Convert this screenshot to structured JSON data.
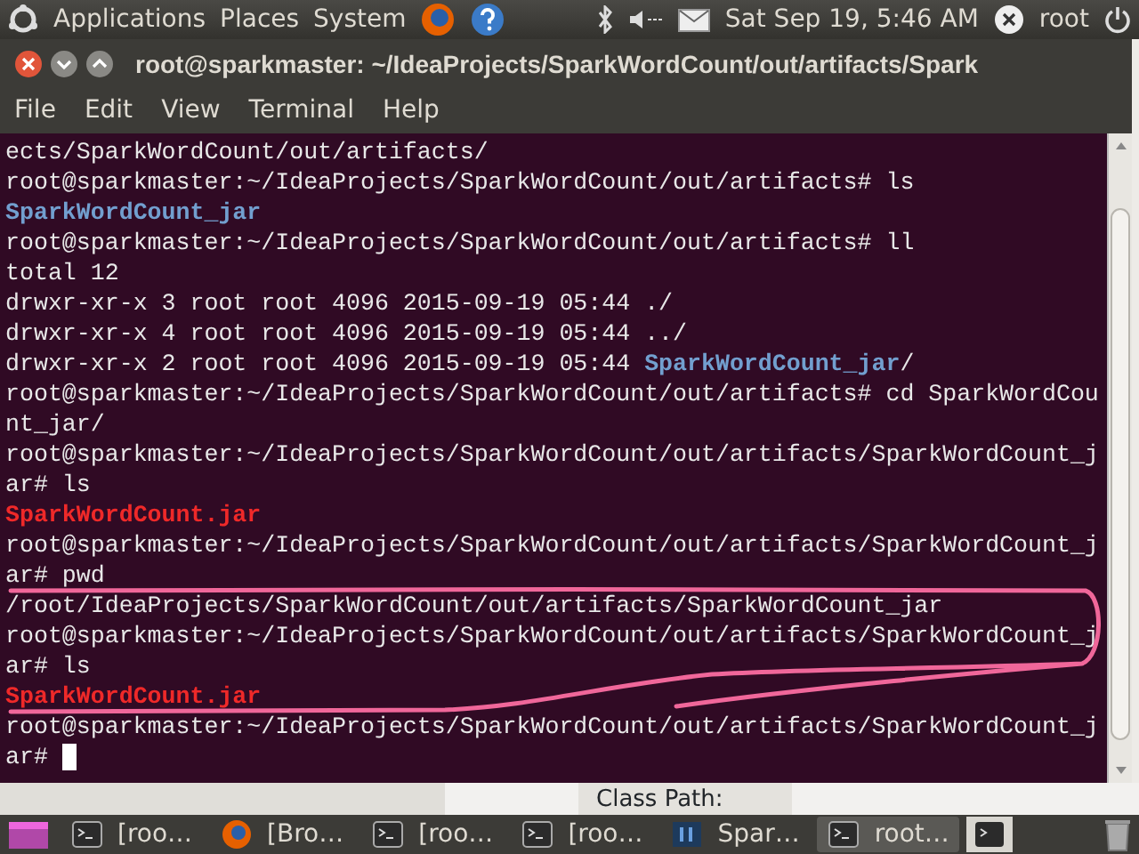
{
  "top_panel": {
    "menus": [
      "Applications",
      "Places",
      "System"
    ],
    "clock": "Sat Sep 19,  5:46 AM",
    "user": "root"
  },
  "window": {
    "title": "root@sparkmaster: ~/IdeaProjects/SparkWordCount/out/artifacts/Spark",
    "menu": [
      "File",
      "Edit",
      "View",
      "Terminal",
      "Help"
    ],
    "terminal": {
      "lines": [
        [
          {
            "text": "ects/SparkWordCount/out/artifacts/",
            "kind": "plain"
          }
        ],
        [
          {
            "text": "root@sparkmaster:~/IdeaProjects/SparkWordCount/out/artifacts# ls",
            "kind": "plain"
          }
        ],
        [
          {
            "text": "SparkWordCount_jar",
            "kind": "dir"
          }
        ],
        [
          {
            "text": "root@sparkmaster:~/IdeaProjects/SparkWordCount/out/artifacts# ll",
            "kind": "plain"
          }
        ],
        [
          {
            "text": "total 12",
            "kind": "plain"
          }
        ],
        [
          {
            "text": "drwxr-xr-x 3 root root 4096 2015-09-19 05:44 ./",
            "kind": "plain"
          }
        ],
        [
          {
            "text": "drwxr-xr-x 4 root root 4096 2015-09-19 05:44 ../",
            "kind": "plain"
          }
        ],
        [
          {
            "text": "drwxr-xr-x 2 root root 4096 2015-09-19 05:44 ",
            "kind": "plain"
          },
          {
            "text": "SparkWordCount_jar",
            "kind": "dir"
          },
          {
            "text": "/",
            "kind": "plain"
          }
        ],
        [
          {
            "text": "root@sparkmaster:~/IdeaProjects/SparkWordCount/out/artifacts# cd SparkWordCou",
            "kind": "plain"
          }
        ],
        [
          {
            "text": "nt_jar/",
            "kind": "plain"
          }
        ],
        [
          {
            "text": "root@sparkmaster:~/IdeaProjects/SparkWordCount/out/artifacts/SparkWordCount_j",
            "kind": "plain"
          }
        ],
        [
          {
            "text": "ar# ls",
            "kind": "plain"
          }
        ],
        [
          {
            "text": "SparkWordCount.jar",
            "kind": "archive"
          }
        ],
        [
          {
            "text": "root@sparkmaster:~/IdeaProjects/SparkWordCount/out/artifacts/SparkWordCount_j",
            "kind": "plain"
          }
        ],
        [
          {
            "text": "ar# pwd",
            "kind": "plain"
          }
        ],
        [
          {
            "text": "/root/IdeaProjects/SparkWordCount/out/artifacts/SparkWordCount_jar",
            "kind": "plain"
          }
        ],
        [
          {
            "text": "root@sparkmaster:~/IdeaProjects/SparkWordCount/out/artifacts/SparkWordCount_j",
            "kind": "plain"
          }
        ],
        [
          {
            "text": "ar# ls",
            "kind": "plain"
          }
        ],
        [
          {
            "text": "SparkWordCount.jar",
            "kind": "archive"
          }
        ],
        [
          {
            "text": "root@sparkmaster:~/IdeaProjects/SparkWordCount/out/artifacts/SparkWordCount_j",
            "kind": "plain"
          }
        ],
        [
          {
            "text": "ar# ",
            "kind": "plain"
          }
        ]
      ]
    }
  },
  "background_window": {
    "label": "Class Path:"
  },
  "taskbar": {
    "items": [
      {
        "label": "[roo…",
        "kind": "terminal",
        "selected": false
      },
      {
        "label": "[Bro…",
        "kind": "browser",
        "selected": false
      },
      {
        "label": "[roo…",
        "kind": "terminal",
        "selected": false
      },
      {
        "label": "[roo…",
        "kind": "terminal",
        "selected": false
      },
      {
        "label": "Spar…",
        "kind": "ide",
        "selected": false
      },
      {
        "label": "root…",
        "kind": "terminal",
        "selected": true
      }
    ]
  }
}
